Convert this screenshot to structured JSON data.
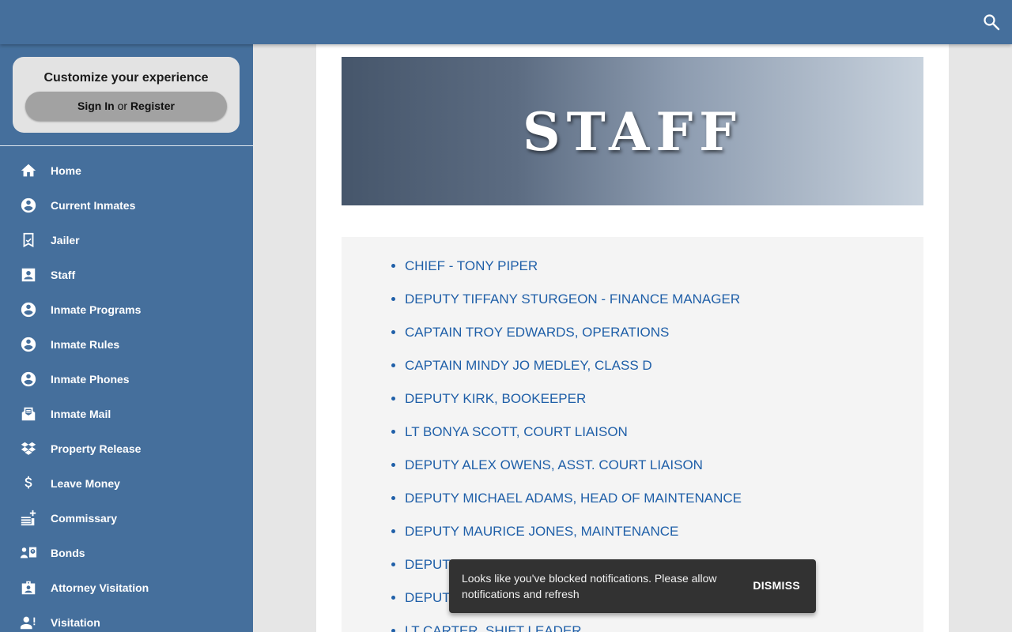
{
  "colors": {
    "header": "#456f9c",
    "sidebar": "#456f9c",
    "link": "#1f5fa8",
    "toast": "#323232"
  },
  "header": {
    "search_icon": "search-icon"
  },
  "customize": {
    "title": "Customize your experience",
    "sign_in": "Sign In",
    "or": "or",
    "register": "Register"
  },
  "sidebar": {
    "items": [
      {
        "label": "Home",
        "icon": "home-icon"
      },
      {
        "label": "Current Inmates",
        "icon": "account-circle-icon"
      },
      {
        "label": "Jailer",
        "icon": "badge-check-icon"
      },
      {
        "label": "Staff",
        "icon": "contact-card-icon"
      },
      {
        "label": "Inmate Programs",
        "icon": "account-circle-icon"
      },
      {
        "label": "Inmate Rules",
        "icon": "account-circle-icon"
      },
      {
        "label": "Inmate Phones",
        "icon": "account-circle-icon"
      },
      {
        "label": "Inmate Mail",
        "icon": "mail-icon"
      },
      {
        "label": "Property Release",
        "icon": "dropbox-icon"
      },
      {
        "label": "Leave Money",
        "icon": "dollar-icon"
      },
      {
        "label": "Commissary",
        "icon": "commissary-icon"
      },
      {
        "label": "Bonds",
        "icon": "bonds-icon"
      },
      {
        "label": "Attorney Visitation",
        "icon": "briefcase-person-icon"
      },
      {
        "label": "Visitation",
        "icon": "person-alert-icon"
      }
    ]
  },
  "banner": {
    "title": "STAFF"
  },
  "staff": [
    "CHIEF - TONY PIPER",
    "DEPUTY TIFFANY STURGEON - FINANCE MANAGER",
    "CAPTAIN TROY EDWARDS, OPERATIONS",
    "CAPTAIN MINDY JO MEDLEY, CLASS D",
    "DEPUTY KIRK, BOOKEEPER",
    "LT BONYA SCOTT, COURT LIAISON",
    "DEPUTY ALEX OWENS, ASST. COURT LIAISON",
    "DEPUTY MICHAEL ADAMS, HEAD OF MAINTENANCE",
    "DEPUTY MAURICE JONES, MAINTENANCE",
    "DEPUT",
    "DEPUT",
    "LT CARTER, SHIFT LEADER"
  ],
  "toast": {
    "message": "Looks like you've blocked notifications. Please allow notifications and refresh",
    "dismiss": "DISMISS"
  }
}
